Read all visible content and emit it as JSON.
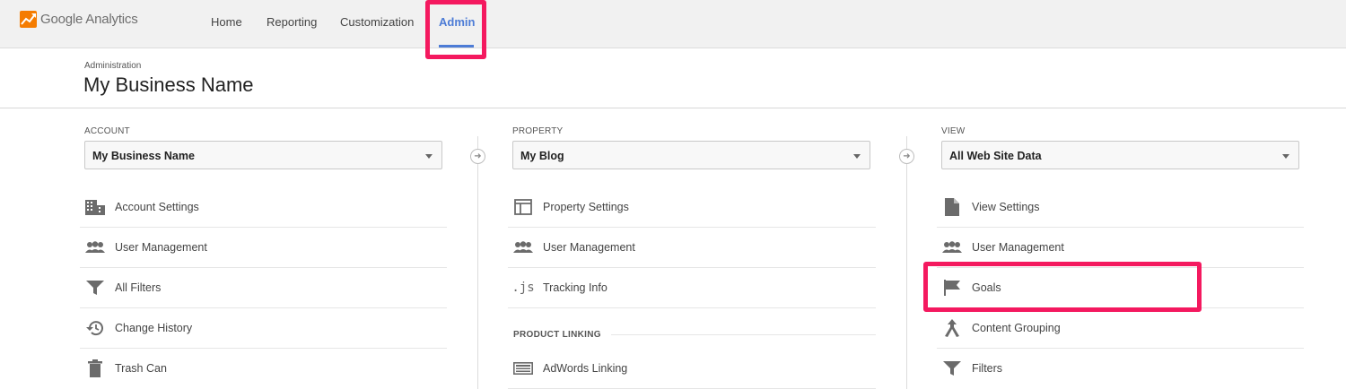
{
  "app": {
    "logo_text": "Google Analytics"
  },
  "nav": {
    "home": "Home",
    "reporting": "Reporting",
    "customization": "Customization",
    "admin": "Admin"
  },
  "header": {
    "breadcrumb": "Administration",
    "title": "My Business Name"
  },
  "account": {
    "label": "ACCOUNT",
    "selected": "My Business Name",
    "items": [
      "Account Settings",
      "User Management",
      "All Filters",
      "Change History",
      "Trash Can"
    ]
  },
  "property": {
    "label": "PROPERTY",
    "selected": "My Blog",
    "items": [
      "Property Settings",
      "User Management",
      "Tracking Info"
    ],
    "section_title": "PRODUCT LINKING",
    "linking_items": [
      "AdWords Linking"
    ]
  },
  "view": {
    "label": "VIEW",
    "selected": "All Web Site Data",
    "items": [
      "View Settings",
      "User Management",
      "Goals",
      "Content Grouping",
      "Filters"
    ]
  },
  "colors": {
    "accent": "#4d7cd6",
    "highlight": "#f4195f",
    "icon": "#6b6b6b"
  }
}
